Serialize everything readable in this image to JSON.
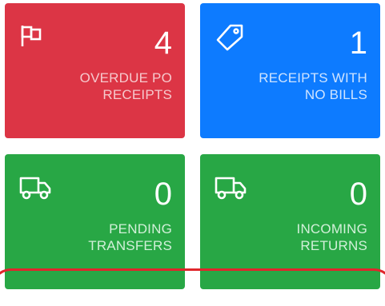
{
  "tiles": [
    {
      "id": "overdue-po-receipts",
      "count": "4",
      "label_line1": "OVERDUE PO",
      "label_line2": "RECEIPTS",
      "icon": "flag-icon",
      "color": "#dc3545"
    },
    {
      "id": "receipts-with-no-bills",
      "count": "1",
      "label_line1": "RECEIPTS WITH",
      "label_line2": "NO BILLS",
      "icon": "tag-icon",
      "color": "#0d7bff"
    },
    {
      "id": "pending-transfers",
      "count": "0",
      "label_line1": "PENDING",
      "label_line2": "TRANSFERS",
      "icon": "truck-icon",
      "color": "#28a745"
    },
    {
      "id": "incoming-returns",
      "count": "0",
      "label_line1": "INCOMING",
      "label_line2": "RETURNS",
      "icon": "truck-icon",
      "color": "#28a745"
    }
  ],
  "accent_color": "#e0262c"
}
